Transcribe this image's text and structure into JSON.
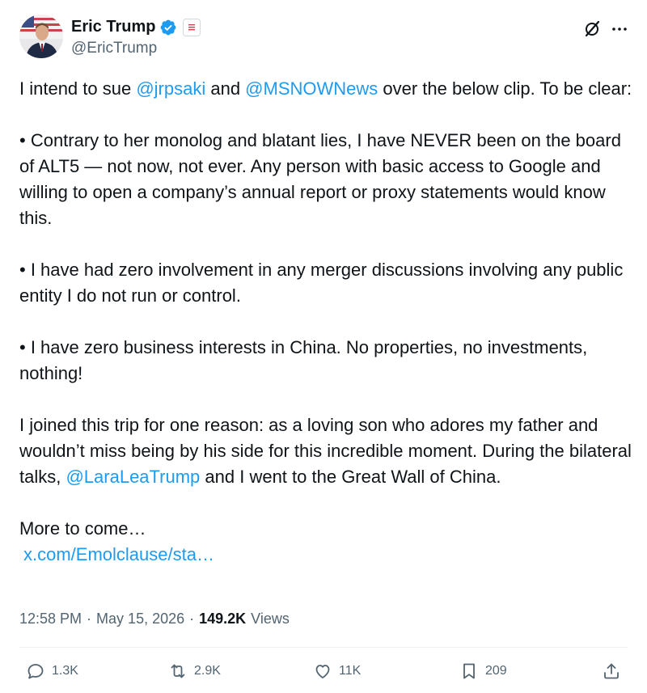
{
  "author": {
    "name": "Eric Trump",
    "handle": "@EricTrump"
  },
  "post": {
    "intro_1": "I intend to sue ",
    "mention_1": "@jrpsaki",
    "intro_2": " and ",
    "mention_2": "@MSNOWNews",
    "intro_3": " over the below clip. To be clear:",
    "bullet_1": "• Contrary to her monolog and blatant lies, I have NEVER been on the board of ALT5 — not now, not ever. Any person with basic access to Google and willing to open a company’s annual report or proxy statements would know this.",
    "bullet_2": "• I have had zero involvement in any merger discussions involving any public entity I do not run or control.",
    "bullet_3": "• I have zero business interests in China. No properties, no investments, nothing!",
    "closing_1": "I joined this trip for one reason: as a loving son who adores my father and wouldn’t miss being by his side for this incredible moment. During the bilateral talks, ",
    "mention_3": "@LaraLeaTrump",
    "closing_2": " and I went to the Great Wall of China.",
    "more": "More to come…",
    "link": "x.com/Emolclause/sta…"
  },
  "meta": {
    "time": "12:58 PM",
    "separator_1": "·",
    "date": "May 15, 2026",
    "separator_2": "·",
    "views_count": "149.2K",
    "views_label": "Views"
  },
  "actions": {
    "replies": "1.3K",
    "reposts": "2.9K",
    "likes": "11K",
    "bookmarks": "209"
  },
  "colors": {
    "link": "#1d9bf0",
    "secondary_text": "#536471",
    "verified": "#1d9bf0"
  }
}
